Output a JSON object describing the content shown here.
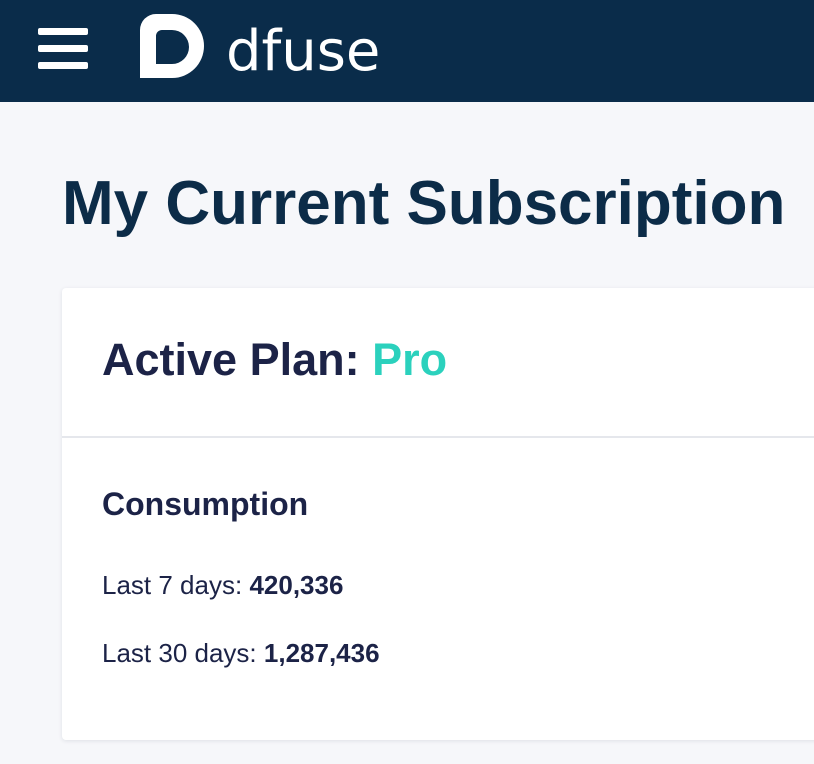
{
  "header": {
    "brand_name": "dfuse",
    "menu_icon": "hamburger-menu-icon",
    "logo_icon": "dfuse-logo-icon",
    "background_color": "#0a2c4a"
  },
  "page": {
    "title": "My Current Subscription"
  },
  "card": {
    "plan_label": "Active Plan:",
    "plan_name": "Pro",
    "plan_color": "#2bd1bd",
    "consumption": {
      "title": "Consumption",
      "rows": [
        {
          "label": "Last 7 days:",
          "value": "420,336"
        },
        {
          "label": "Last 30 days:",
          "value": "1,287,436"
        }
      ]
    }
  }
}
